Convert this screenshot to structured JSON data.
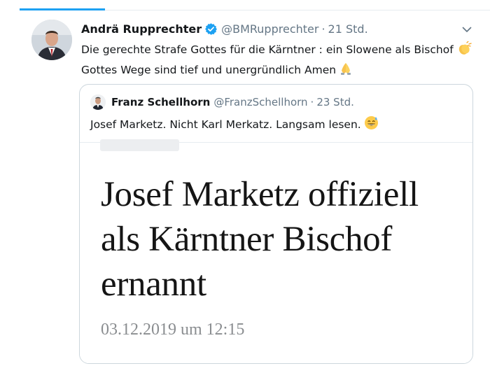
{
  "tweet": {
    "author_name": "Andrä Rupprechter",
    "author_handle": "@BMRupprechter",
    "separator": "·",
    "time": "21 Std.",
    "text_line1": "Die gerechte Strafe Gottes für die Kärntner : ein Slowene als Bischof",
    "text_line2": "Gottes Wege sind tief und unergründlich Amen",
    "emoji1": "clapping-hands-emoji",
    "emoji2": "folded-hands-emoji"
  },
  "quoted_tweet": {
    "author_name": "Franz Schellhorn",
    "author_handle": "@FranzSchellhorn",
    "separator": "·",
    "time": "23 Std.",
    "text": "Josef Marketz. Nicht Karl Merkatz. Langsam lesen.",
    "emoji": "grinning-sweat-emoji",
    "card": {
      "headline_line1": "Josef Marketz offiziell",
      "headline_line2": "als Kärntner Bischof",
      "headline_line3": "ernannt",
      "date": "03.12.2019 um 12:15"
    }
  },
  "colors": {
    "accent": "#1da1f2",
    "secondary_text": "#657786",
    "border": "#ccd6dd"
  }
}
